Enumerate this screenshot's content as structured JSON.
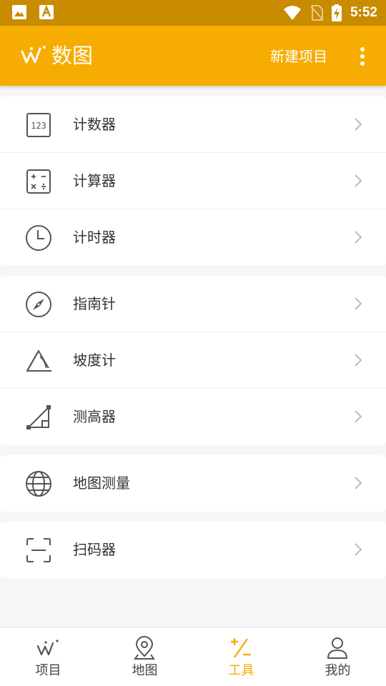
{
  "status_bar": {
    "time": "5:52"
  },
  "app_bar": {
    "title": "数图",
    "new_project_label": "新建项目"
  },
  "tool_groups": [
    {
      "items": [
        {
          "label": "计数器",
          "icon": "counter-123-icon"
        },
        {
          "label": "计算器",
          "icon": "calculator-icon"
        },
        {
          "label": "计时器",
          "icon": "clock-icon"
        }
      ]
    },
    {
      "items": [
        {
          "label": "指南针",
          "icon": "compass-icon"
        },
        {
          "label": "坡度计",
          "icon": "slope-angle-icon"
        },
        {
          "label": "测高器",
          "icon": "height-measure-icon"
        }
      ]
    },
    {
      "items": [
        {
          "label": "地图测量",
          "icon": "globe-icon"
        }
      ]
    },
    {
      "items": [
        {
          "label": "扫码器",
          "icon": "scan-icon"
        }
      ]
    }
  ],
  "bottom_nav": {
    "active_index": 2,
    "accent_color": "#f7ac02",
    "items": [
      {
        "label": "项目",
        "icon": "projects-logo-icon"
      },
      {
        "label": "地图",
        "icon": "map-pin-icon"
      },
      {
        "label": "工具",
        "icon": "plus-minus-icon"
      },
      {
        "label": "我的",
        "icon": "person-icon"
      }
    ]
  },
  "colors": {
    "app_bar": "#f7ac02",
    "status_bar": "#c98b00",
    "background": "#f6f6f6"
  }
}
